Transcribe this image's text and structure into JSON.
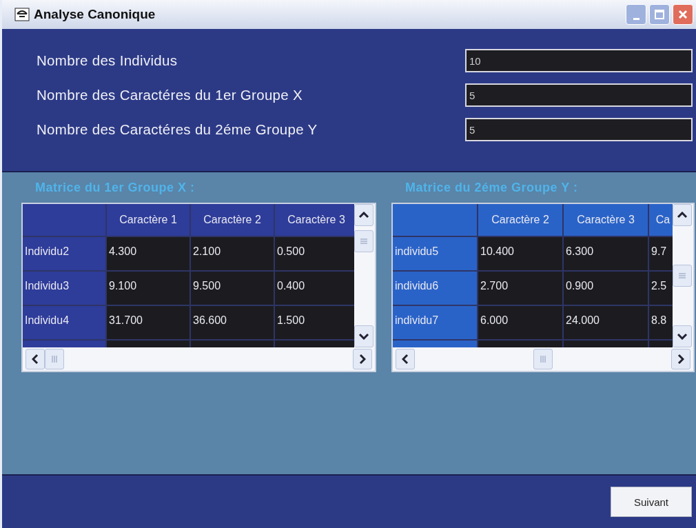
{
  "window": {
    "title": "Analyse Canonique"
  },
  "fields": [
    {
      "label": "Nombre des Individus",
      "value": "10"
    },
    {
      "label": "Nombre des Caractéres du 1er Groupe  X",
      "value": "5"
    },
    {
      "label": "Nombre des Caractéres du 2éme Groupe  Y",
      "value": "5"
    }
  ],
  "matrices": [
    {
      "title": "Matrice du 1er Groupe  X :",
      "columns": [
        "Caractère 1",
        "Caractère 2",
        "Caractère 3"
      ],
      "rows": [
        {
          "header": "Individu2",
          "cells": [
            "4.300",
            "2.100",
            "0.500"
          ]
        },
        {
          "header": "Individu3",
          "cells": [
            "9.100",
            "9.500",
            "0.400"
          ]
        },
        {
          "header": "Individu4",
          "cells": [
            "31.700",
            "36.600",
            "1.500"
          ]
        }
      ]
    },
    {
      "title": "Matrice du 2éme Groupe Y :",
      "columns": [
        "Caractère 2",
        "Caractère 3",
        "Ca"
      ],
      "rows": [
        {
          "header": "individu5",
          "cells": [
            "10.400",
            "6.300",
            "9.7"
          ]
        },
        {
          "header": "individu6",
          "cells": [
            "2.700",
            "0.900",
            "2.5"
          ]
        },
        {
          "header": "individu7",
          "cells": [
            "6.000",
            "24.000",
            "8.8"
          ]
        }
      ]
    }
  ],
  "buttons": [
    {
      "label": "Suivant"
    }
  ]
}
